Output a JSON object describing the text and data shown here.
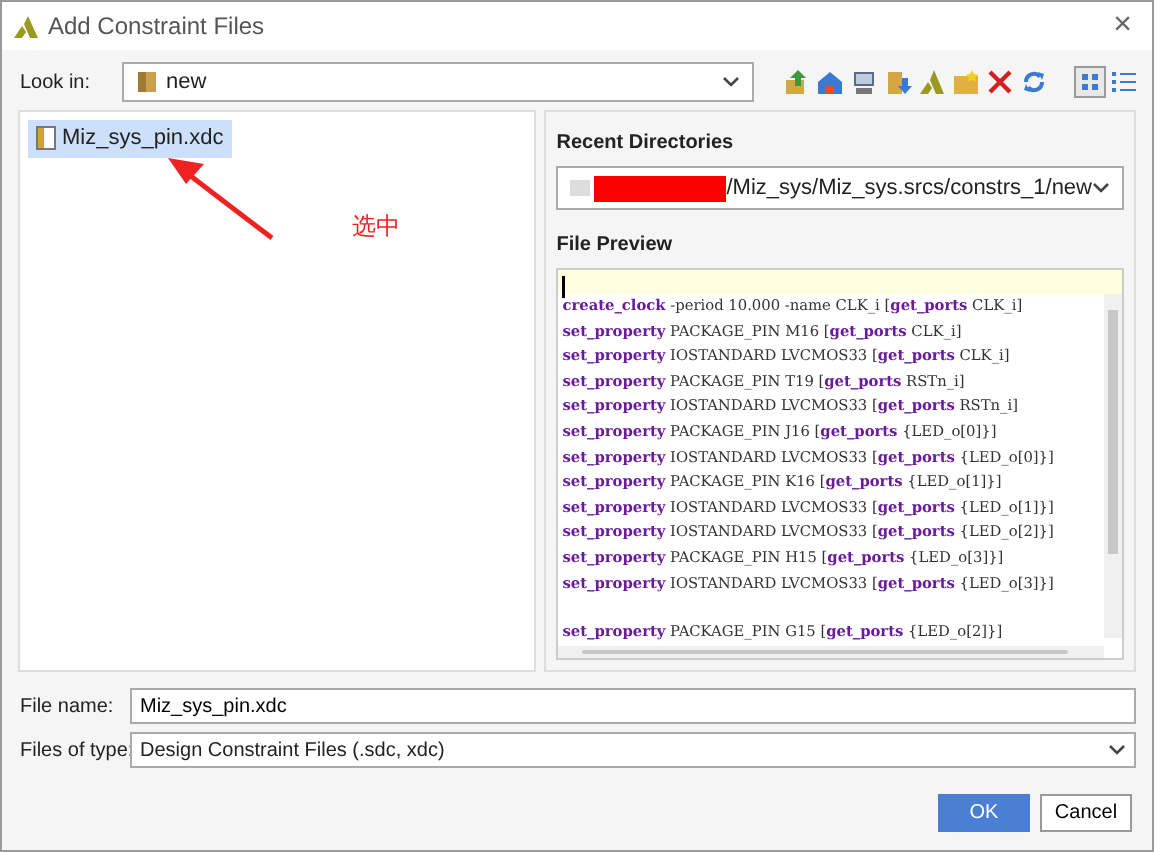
{
  "window": {
    "title": "Add Constraint Files",
    "close": "×"
  },
  "look_in": {
    "label": "Look in:",
    "value": "new"
  },
  "files": [
    {
      "name": "Miz_sys_pin.xdc",
      "selected": true
    }
  ],
  "annotation": {
    "text": "选中"
  },
  "recent": {
    "label": "Recent Directories",
    "redacted": true,
    "path": "/Miz_sys/Miz_sys.srcs/constrs_1/new"
  },
  "preview": {
    "label": "File Preview",
    "lines": [
      {
        "text": "**create_clock** -period 10.000 -name CLK_i [**get_ports** CLK_i]",
        "gap_before": false
      },
      {
        "text": "**set_property** PACKAGE_PIN M16 [**get_ports** CLK_i]",
        "gap_before": false
      },
      {
        "text": "**set_property** IOSTANDARD LVCMOS33 [**get_ports** CLK_i]",
        "gap_before": false
      },
      {
        "text": "**set_property** PACKAGE_PIN T19 [**get_ports** RSTn_i]",
        "gap_before": false
      },
      {
        "text": "**set_property** IOSTANDARD LVCMOS33 [**get_ports** RSTn_i]",
        "gap_before": false
      },
      {
        "text": "**set_property** PACKAGE_PIN J16 [**get_ports** {LED_o[0]}]",
        "gap_before": false
      },
      {
        "text": "**set_property** IOSTANDARD LVCMOS33 [**get_ports** {LED_o[0]}]",
        "gap_before": false
      },
      {
        "text": "**set_property** PACKAGE_PIN K16 [**get_ports** {LED_o[1]}]",
        "gap_before": false
      },
      {
        "text": "**set_property** IOSTANDARD LVCMOS33 [**get_ports** {LED_o[1]}]",
        "gap_before": false
      },
      {
        "text": "**set_property** IOSTANDARD LVCMOS33 [**get_ports** {LED_o[2]}]",
        "gap_before": false
      },
      {
        "text": "**set_property** PACKAGE_PIN H15 [**get_ports** {LED_o[3]}]",
        "gap_before": false
      },
      {
        "text": "**set_property** IOSTANDARD LVCMOS33 [**get_ports** {LED_o[3]}]",
        "gap_before": false
      },
      {
        "text": "**set_property** PACKAGE_PIN G15 [**get_ports** {LED_o[2]}]",
        "gap_before": true
      }
    ]
  },
  "file_name": {
    "label": "File name:",
    "value": "Miz_sys_pin.xdc"
  },
  "file_type": {
    "label": "Files of type:",
    "value": "Design Constraint Files (.sdc, xdc)"
  },
  "buttons": [
    {
      "label": "OK",
      "kind": "primary"
    },
    {
      "label": "Cancel",
      "kind": "secondary"
    }
  ]
}
